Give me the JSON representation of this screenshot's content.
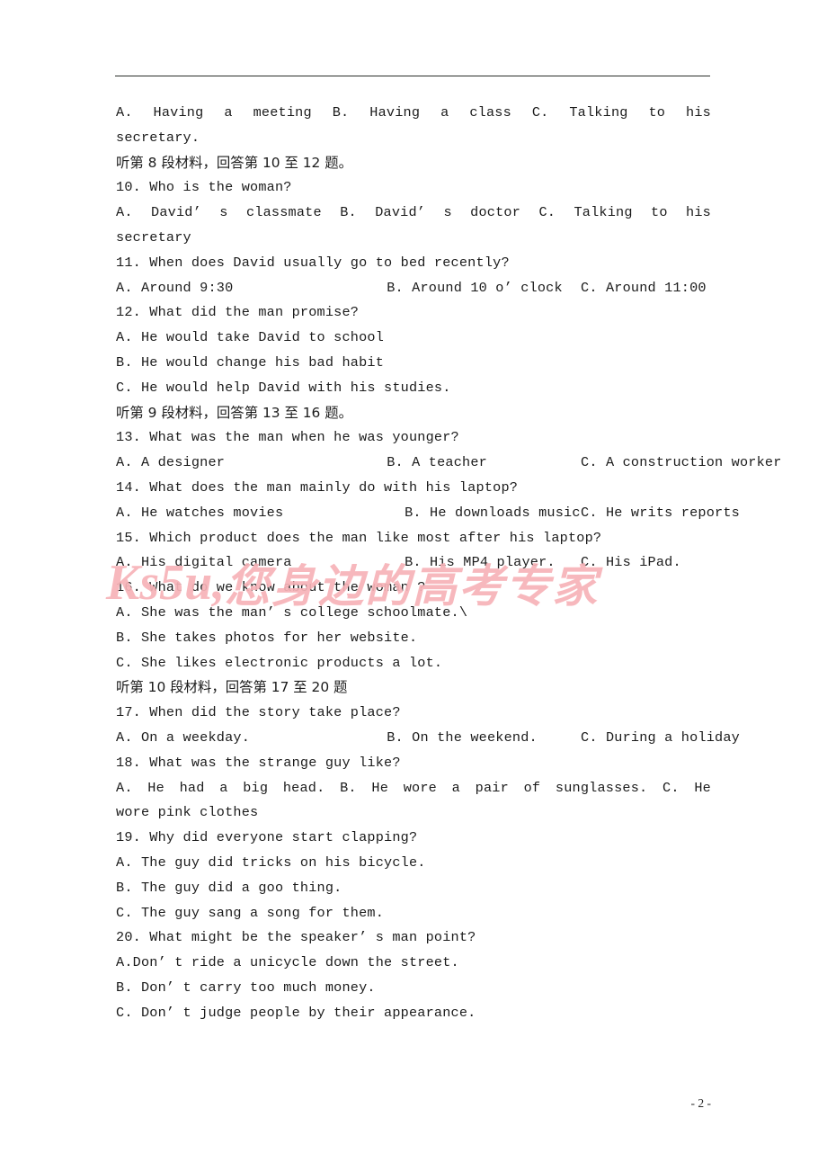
{
  "page": {
    "footer_page_number": "- 2 -",
    "header_rule": true,
    "watermark": {
      "latin": "Ks5u,",
      "cjk": "您身边的高考专家",
      "color": "#f7b3b8"
    }
  },
  "body": {
    "blocks": [
      {
        "id": "q09-options-cont",
        "type": "options3-justified",
        "a": "A. Having a meeting",
        "b": "B. Having a class",
        "c": "C.  Talking  to  his"
      },
      {
        "id": "q09-wrap",
        "type": "text",
        "text": "secretary."
      },
      {
        "id": "dir-08",
        "type": "cn",
        "text": "听第 8 段材料，回答第 10 至 12 题。"
      },
      {
        "id": "q10",
        "type": "text",
        "text": "10. Who is the woman?"
      },
      {
        "id": "q10-options",
        "type": "options3-justified",
        "a": "A. David’ s classmate",
        "b": "B. David’ s doctor",
        "c": "C.  Talking  to  his"
      },
      {
        "id": "q10-wrap",
        "type": "text",
        "text": "secretary"
      },
      {
        "id": "q11",
        "type": "text",
        "text": "11. When does David usually go to bed recently?"
      },
      {
        "id": "q11-options",
        "type": "options3",
        "a": "A. Around 9:30",
        "b": "B. Around 10 o’ clock",
        "c": "C. Around 11:00"
      },
      {
        "id": "q12",
        "type": "text",
        "text": "12. What did the man promise?"
      },
      {
        "id": "q12-a",
        "type": "text",
        "text": "A. He would take David to school"
      },
      {
        "id": "q12-b",
        "type": "text",
        "text": "B. He would change his bad habit"
      },
      {
        "id": "q12-c",
        "type": "text",
        "text": "C. He would help David with his studies."
      },
      {
        "id": "dir-09",
        "type": "cn",
        "text": "听第 9 段材料，回答第 13 至 16 题。"
      },
      {
        "id": "q13",
        "type": "text",
        "text": "13. What was the man when he was younger?"
      },
      {
        "id": "q13-options",
        "type": "options3",
        "a": "A. A designer",
        "b": "B. A teacher",
        "c": "C. A construction worker"
      },
      {
        "id": "q14",
        "type": "text",
        "text": "14. What does the man mainly do with his laptop?"
      },
      {
        "id": "q14-options",
        "type": "options3b",
        "a": "A. He watches movies",
        "b": "B. He downloads music",
        "c": "C. He writs reports"
      },
      {
        "id": "q15",
        "type": "text",
        "text": "15. Which product does the man like most after his laptop?"
      },
      {
        "id": "q15-options",
        "type": "options3b",
        "a": "A. His digital camera",
        "b": "B. His MP4 player.",
        "c": "C. His iPad."
      },
      {
        "id": "q16",
        "type": "text",
        "text": "16. What do we know about the woman ?"
      },
      {
        "id": "q16-a",
        "type": "text",
        "text": "A. She was the man’ s college schoolmate.\\"
      },
      {
        "id": "q16-b",
        "type": "text",
        "text": "B. She takes photos for her website."
      },
      {
        "id": "q16-c",
        "type": "text",
        "text": "C. She likes electronic products a lot."
      },
      {
        "id": "dir-10",
        "type": "cn",
        "text": "听第 10 段材料，回答第 17 至 20 题"
      },
      {
        "id": "q17",
        "type": "text",
        "text": "17. When did the story take place?"
      },
      {
        "id": "q17-options",
        "type": "options3",
        "a": "A. On a weekday.",
        "b": "B. On the weekend.",
        "c": "C. During a holiday"
      },
      {
        "id": "q18",
        "type": "text",
        "text": "18. What was the strange guy like?"
      },
      {
        "id": "q18-options",
        "type": "options3-justified",
        "a": "A. He had a big head.",
        "b": "B. He wore a pair of sunglasses.",
        "c": "C.    He"
      },
      {
        "id": "q18-wrap",
        "type": "text",
        "text": "wore pink clothes"
      },
      {
        "id": "q19",
        "type": "text",
        "text": "19. Why did everyone start clapping?"
      },
      {
        "id": "q19-a",
        "type": "text",
        "text": "A. The guy did tricks on his bicycle."
      },
      {
        "id": "q19-b",
        "type": "text",
        "text": "B. The guy did a goo thing."
      },
      {
        "id": "q19-c",
        "type": "text",
        "text": "C. The guy sang a song for them."
      },
      {
        "id": "q20",
        "type": "text",
        "text": "20. What might be the speaker’ s man point?"
      },
      {
        "id": "q20-a",
        "type": "text",
        "text": "A.Don’ t ride a unicycle down the street."
      },
      {
        "id": "q20-b",
        "type": "text",
        "text": "B. Don’ t carry too much money."
      },
      {
        "id": "q20-c",
        "type": "text",
        "text": "C. Don’ t judge people by their appearance."
      }
    ]
  }
}
